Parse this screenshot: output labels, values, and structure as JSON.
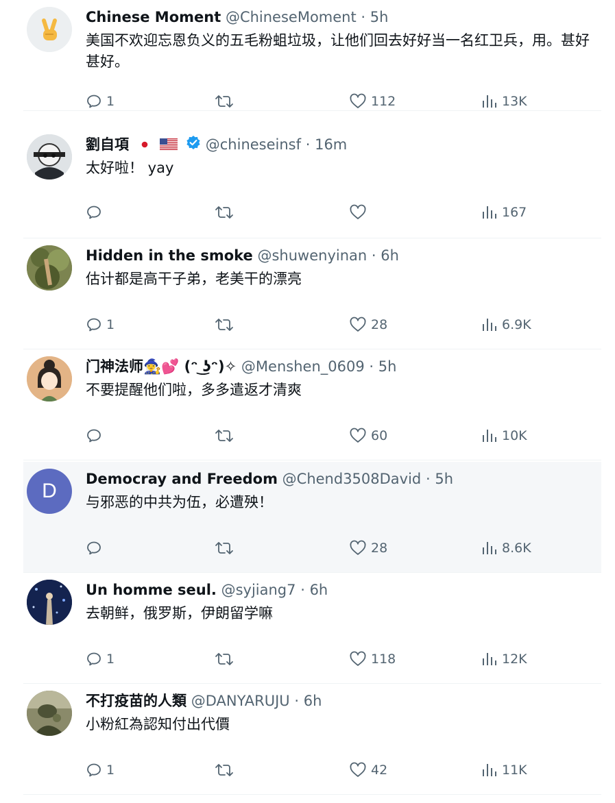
{
  "colors": {
    "text": "#0f1419",
    "muted": "#536471",
    "verified": "#1d9bf0",
    "highlight_bg": "#f5f7f9",
    "divider": "#eff3f4"
  },
  "tweets": [
    {
      "name": "Chinese Moment",
      "name_emoji": "",
      "handle": "@ChineseMoment",
      "time": "5h",
      "text": "美国不欢迎忘恩负义的五毛粉蛆垃圾，让他们回去好好当一名红卫兵，用。甚好甚好。",
      "replies": "1",
      "likes": "112",
      "views": "13K",
      "avatar_icon": "victory-hand-icon"
    },
    {
      "name": "劉自項",
      "name_emoji": "",
      "handle": "@chineseinsf",
      "time": "16m",
      "text": "太好啦！ yay",
      "replies": "",
      "likes": "",
      "views": "167",
      "flags": [
        "japan-flag-icon",
        "us-flag-icon"
      ],
      "verified": true,
      "avatar_icon": "masked-character-avatar"
    },
    {
      "name": "Hidden in the smoke",
      "name_emoji": "",
      "handle": "@shuwenyinan",
      "time": "6h",
      "text": "估计都是高干子弟，老美干的漂亮",
      "replies": "1",
      "likes": "28",
      "views": "6.9K",
      "avatar_icon": "foliage-photo-avatar"
    },
    {
      "name": "门神法师",
      "name_emoji": "🧙‍♀️💕 (ᵔ ͜ʖᵔ)✧",
      "handle": "@Menshen_0609",
      "time": "5h",
      "text": "不要提醒他们啦，多多遣返才清爽",
      "replies": "",
      "likes": "60",
      "views": "10K",
      "avatar_icon": "cartoon-woman-avatar"
    },
    {
      "name": "Democray and Freedom",
      "name_emoji": "",
      "handle": "@Chend3508David",
      "time": "5h",
      "text": "与邪恶的中共为伍，必遭殃！",
      "replies": "",
      "likes": "28",
      "views": "8.6K",
      "avatar_letter": "D",
      "avatar_color": "#5c6bc0",
      "avatar_icon": "letter-d-avatar"
    },
    {
      "name": "Un homme seul.",
      "name_emoji": "",
      "handle": "@syjiang7",
      "time": "6h",
      "text": "去朝鲜，俄罗斯，伊朗留学嘛",
      "replies": "1",
      "likes": "118",
      "views": "12K",
      "avatar_icon": "night-sky-avatar"
    },
    {
      "name": "不打疫苗的人類",
      "name_emoji": "",
      "handle": "@DANYARUJU",
      "time": "6h",
      "text": "小粉紅為認知付出代價",
      "replies": "1",
      "likes": "42",
      "views": "11K",
      "avatar_icon": "soldier-photo-avatar"
    }
  ],
  "separator": "·"
}
